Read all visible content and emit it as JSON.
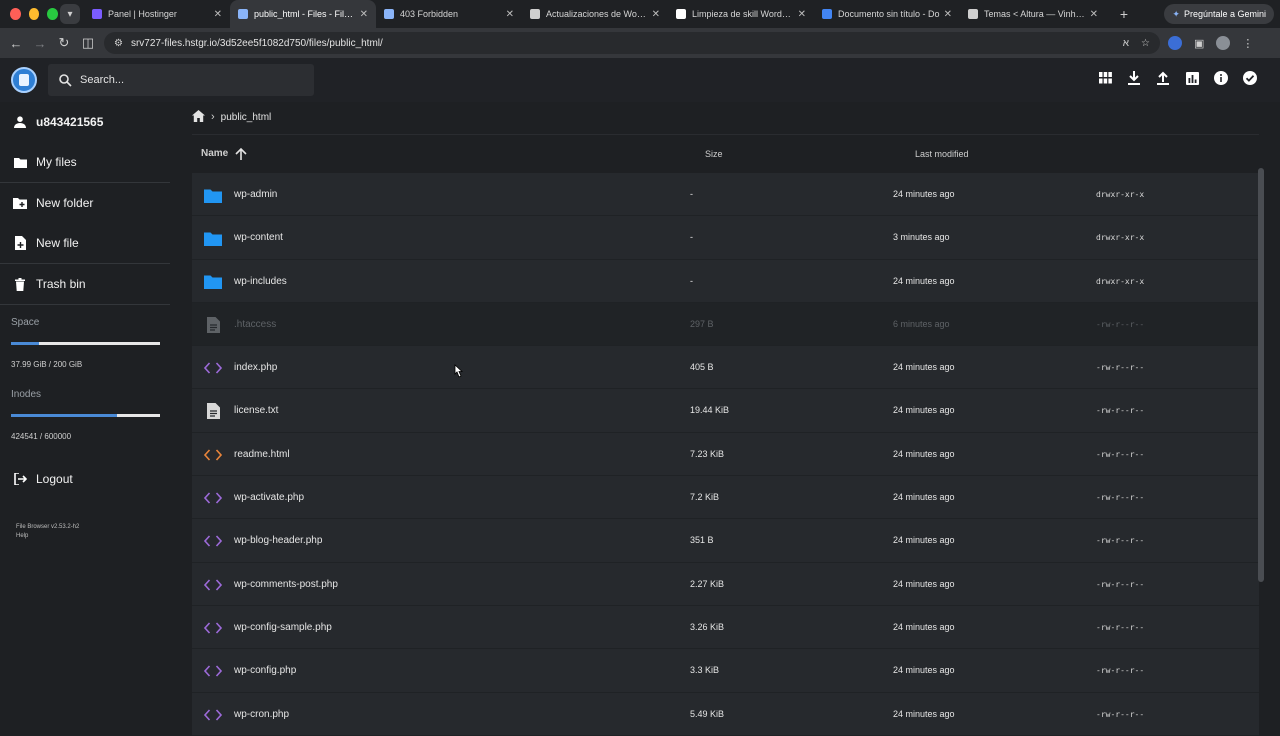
{
  "browser": {
    "tabs": [
      {
        "label": "Panel | Hostinger",
        "color": "#7b5cff"
      },
      {
        "label": "public_html - Files - File B",
        "color": "#8ab4f8",
        "active": true
      },
      {
        "label": "403 Forbidden",
        "color": "#8ab4f8"
      },
      {
        "label": "Actualizaciones de WordPr",
        "color": "#cfcfcf"
      },
      {
        "label": "Limpieza de skill WordPres",
        "color": "#ffffff"
      },
      {
        "label": "Documento sin título - Do",
        "color": "#4285f4"
      },
      {
        "label": "Temas < Altura — Vinhos d",
        "color": "#cfcfcf"
      }
    ],
    "gemini_label": "Pregúntale a Gemini",
    "url": "srv727-files.hstgr.io/3d52ee5f1082d750/files/public_html/"
  },
  "header": {
    "search_placeholder": "Search..."
  },
  "sidebar": {
    "user": "u843421565",
    "my_files": "My files",
    "new_folder": "New folder",
    "new_file": "New file",
    "trash_bin": "Trash bin",
    "space_label": "Space",
    "space_value": "37.99 GiB / 200 GiB",
    "space_fraction": 0.19,
    "inodes_label": "Inodes",
    "inodes_value": "424541 / 600000",
    "inodes_fraction": 0.71,
    "logout": "Logout",
    "version": "File Browser v2.53.2-h2",
    "help": "Help"
  },
  "main": {
    "breadcrumb": "public_html",
    "columns": {
      "name": "Name",
      "size": "Size",
      "modified": "Last modified"
    },
    "rows": [
      {
        "type": "folder",
        "name": "wp-admin",
        "size": "-",
        "modified": "24 minutes ago",
        "perm": "drwxr-xr-x"
      },
      {
        "type": "folder",
        "name": "wp-content",
        "size": "-",
        "modified": "3 minutes ago",
        "perm": "drwxr-xr-x"
      },
      {
        "type": "folder",
        "name": "wp-includes",
        "size": "-",
        "modified": "24 minutes ago",
        "perm": "drwxr-xr-x"
      },
      {
        "type": "text",
        "name": ".htaccess",
        "size": "297 B",
        "modified": "6 minutes ago",
        "perm": "-rw-r--r--",
        "dim": true
      },
      {
        "type": "code",
        "name": "index.php",
        "size": "405 B",
        "modified": "24 minutes ago",
        "perm": "-rw-r--r--"
      },
      {
        "type": "text",
        "name": "license.txt",
        "size": "19.44 KiB",
        "modified": "24 minutes ago",
        "perm": "-rw-r--r--"
      },
      {
        "type": "html",
        "name": "readme.html",
        "size": "7.23 KiB",
        "modified": "24 minutes ago",
        "perm": "-rw-r--r--"
      },
      {
        "type": "code",
        "name": "wp-activate.php",
        "size": "7.2 KiB",
        "modified": "24 minutes ago",
        "perm": "-rw-r--r--"
      },
      {
        "type": "code",
        "name": "wp-blog-header.php",
        "size": "351 B",
        "modified": "24 minutes ago",
        "perm": "-rw-r--r--"
      },
      {
        "type": "code",
        "name": "wp-comments-post.php",
        "size": "2.27 KiB",
        "modified": "24 minutes ago",
        "perm": "-rw-r--r--"
      },
      {
        "type": "code",
        "name": "wp-config-sample.php",
        "size": "3.26 KiB",
        "modified": "24 minutes ago",
        "perm": "-rw-r--r--"
      },
      {
        "type": "code",
        "name": "wp-config.php",
        "size": "3.3 KiB",
        "modified": "24 minutes ago",
        "perm": "-rw-r--r--"
      },
      {
        "type": "code",
        "name": "wp-cron.php",
        "size": "5.49 KiB",
        "modified": "24 minutes ago",
        "perm": "-rw-r--r--"
      }
    ]
  },
  "colors": {
    "folder": "#2196f3",
    "code": "#9c6ad8",
    "html": "#e8843a",
    "accent": "#4a8ad6"
  }
}
